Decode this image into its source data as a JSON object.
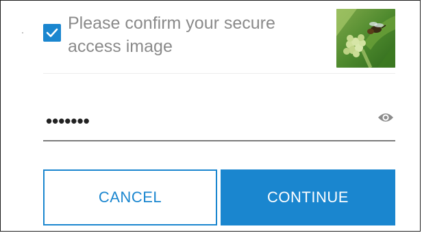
{
  "confirm": {
    "checked": true,
    "label": "Please confirm your secure access image"
  },
  "password": {
    "masked_value": "•••••••",
    "visibility_icon": "eye-icon"
  },
  "buttons": {
    "cancel_label": "CANCEL",
    "continue_label": "CONTINUE"
  },
  "colors": {
    "accent": "#1a86cf",
    "label_text": "#8a8a8a",
    "underline": "#7a7a7a"
  }
}
